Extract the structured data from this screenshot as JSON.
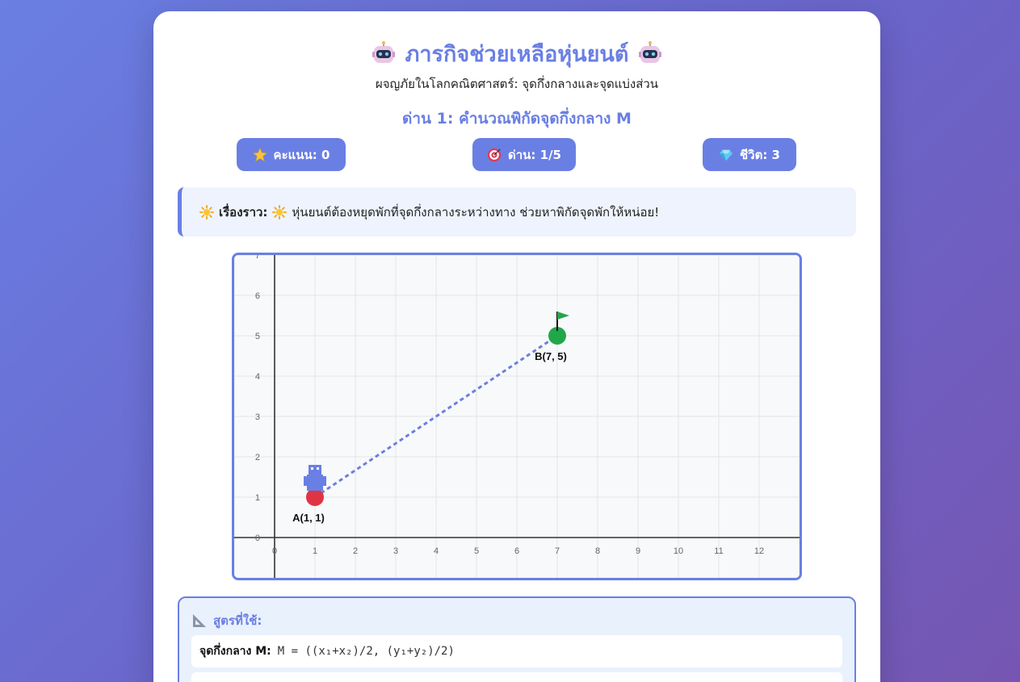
{
  "header": {
    "title": "ภารกิจช่วยเหลือหุ่นยนต์",
    "title_icon": "robot-icon",
    "subtitle": "ผจญภัยในโลกคณิตศาสตร์: จุดกึ่งกลางและจุดแบ่งส่วน",
    "level_title": "ด่าน 1: คำนวณพิกัดจุดกึ่งกลาง M"
  },
  "stats": {
    "score": "คะแนน: 0",
    "level": "ด่าน: 1/5",
    "lives": "ชีวิต: 3"
  },
  "story": {
    "label": "เรื่องราว:",
    "text": "หุ่นยนต์ต้องหยุดพักที่จุดกึ่งกลางระหว่างทาง ช่วยหาพิกัดจุดพักให้หน่อย!"
  },
  "chart_data": {
    "type": "scatter",
    "x_ticks": [
      "0",
      "1",
      "2",
      "3",
      "4",
      "5",
      "6",
      "7",
      "8",
      "9",
      "10",
      "11",
      "12"
    ],
    "y_ticks": [
      "0",
      "1",
      "2",
      "3",
      "4",
      "5",
      "6",
      "7"
    ],
    "xlim": [
      -1,
      13
    ],
    "ylim": [
      -1,
      7
    ],
    "grid": true,
    "points": [
      {
        "name": "A",
        "label": "A(1, 1)",
        "x": 1,
        "y": 1,
        "color": "#e03444"
      },
      {
        "name": "B",
        "label": "B(7, 5)",
        "x": 7,
        "y": 5,
        "color": "#22a64a"
      }
    ],
    "segment": {
      "from": "A",
      "to": "B",
      "style": "dashed",
      "color": "#6a7fe3"
    }
  },
  "formulas": {
    "heading": "สูตรที่ใช้:",
    "midpoint_label": "จุดกึ่งกลาง M:",
    "midpoint_expr": "M = ((x₁+x₂)/2, (y₁+y₂)/2)"
  },
  "colors": {
    "accent": "#6a7fe3",
    "point_a": "#e03444",
    "point_b": "#22a64a"
  }
}
